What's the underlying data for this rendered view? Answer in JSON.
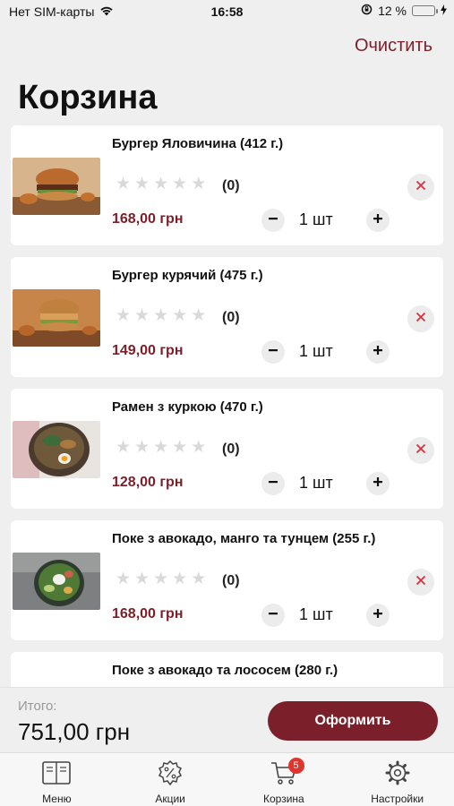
{
  "status_bar": {
    "carrier": "Нет SIM-карты",
    "time": "16:58",
    "battery_text": "12 %",
    "battery_level": 0.12
  },
  "header": {
    "clear_label": "Очистить",
    "title": "Корзина"
  },
  "cart": {
    "items": [
      {
        "name": "Бургер Яловичина (412 г.)",
        "rating": "(0)",
        "price": "168,00 грн",
        "quantity": "1 шт",
        "stars_filled": 0,
        "stars_total": 5,
        "image": "burger-photo"
      },
      {
        "name": "Бургер курячий (475 г.)",
        "rating": "(0)",
        "price": "149,00 грн",
        "quantity": "1 шт",
        "stars_filled": 0,
        "stars_total": 5,
        "image": "burger-photo"
      },
      {
        "name": "Рамен з куркою (470 г.)",
        "rating": "(0)",
        "price": "128,00 грн",
        "quantity": "1 шт",
        "stars_filled": 0,
        "stars_total": 5,
        "image": "ramen-photo"
      },
      {
        "name": "Поке з авокадо, манго та тунцем (255 г.)",
        "rating": "(0)",
        "price": "168,00 грн",
        "quantity": "1 шт",
        "stars_filled": 0,
        "stars_total": 5,
        "image": "poke-photo"
      },
      {
        "name": "Поке з авокадо та лососем (280 г.)"
      }
    ]
  },
  "footer": {
    "total_label": "Итого:",
    "total_value": "751,00 грн",
    "checkout_label": "Оформить"
  },
  "tabbar": {
    "tabs": [
      {
        "label": "Меню",
        "icon": "menu-book-icon"
      },
      {
        "label": "Акции",
        "icon": "discount-badge-icon"
      },
      {
        "label": "Корзина",
        "icon": "cart-icon",
        "badge": "5"
      },
      {
        "label": "Настройки",
        "icon": "gear-icon"
      }
    ]
  },
  "colors": {
    "accent": "#7b1f2a",
    "badge": "#e0342d",
    "background": "#efefef"
  }
}
